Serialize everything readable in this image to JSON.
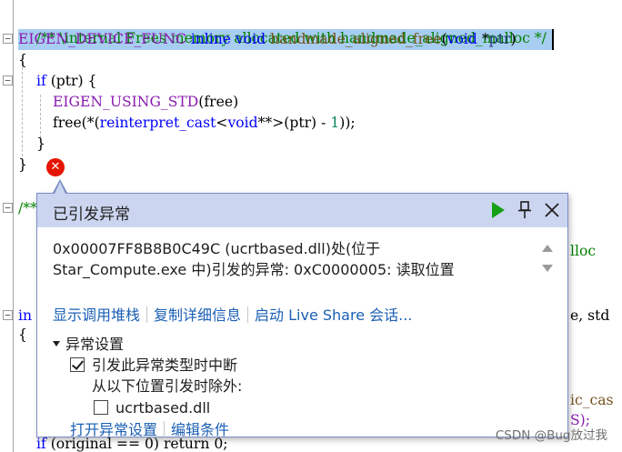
{
  "code": {
    "lines": {
      "l1": "/** \\internal Frees memory allocated with handmade_aligned_malloc */",
      "l2_macro": "EIGEN_DEVICE_FUNC",
      "l2_kw1": "inline",
      "l2_kw2": "void",
      "l2_fn": "handmade_aligned_free",
      "l2_p1": "(",
      "l2_kw3": "void",
      "l2_p2": " *",
      "l2_id": "ptr",
      "l2_p3": ")",
      "l3": "{",
      "l4_kw": "if",
      "l4_rest": " (ptr) {",
      "l5_macro": "EIGEN_USING_STD",
      "l5_rest": "(free)",
      "l6_a": "free(*(",
      "l6_kw": "reinterpret_cast",
      "l6_b": "<",
      "l6_kw2": "void",
      "l6_c": "**>(ptr) - ",
      "l6_num": "1",
      "l6_d": "));",
      "l7": "}",
      "l8": "}",
      "l9": "/**",
      "l10_tail": "lloc",
      "l11_head": "in",
      "l11_tail": "e, std",
      "l12": "{",
      "l13_tail": "ic_cas",
      "l14_tail": "S);",
      "l15_kw": "if",
      "l15_rest": " (original == 0) return 0;"
    }
  },
  "popup": {
    "title": "已引发异常",
    "message_line1": "0x00007FF8B8B0C49C (ucrtbased.dll)处(位于",
    "message_line2": "Star_Compute.exe 中)引发的异常: 0xC0000005: 读取位置",
    "links": {
      "call_stack": "显示调用堆栈",
      "copy_details": "复制详细信息",
      "live_share": "启动 Live Share 会话..."
    },
    "settings": {
      "header": "异常设置",
      "break_when_thrown": "引发此异常类型时中断",
      "break_when_thrown_checked": true,
      "except_from_label": "从以下位置引发时除外:",
      "module": "ucrtbased.dll",
      "module_checked": false
    },
    "bottom_links": {
      "open_settings": "打开异常设置",
      "edit_conditions": "编辑条件"
    }
  },
  "watermark": "CSDN @Bug放过我",
  "colors": {
    "header_bg": "#ccd5f0",
    "link": "#1a5fb4",
    "continue_green": "#16a016",
    "error_red": "#e51400",
    "selection": "#a7cdf0"
  },
  "icons": {
    "continue": "play-icon",
    "pin": "pin-icon",
    "close": "close-icon",
    "error": "error-icon"
  }
}
